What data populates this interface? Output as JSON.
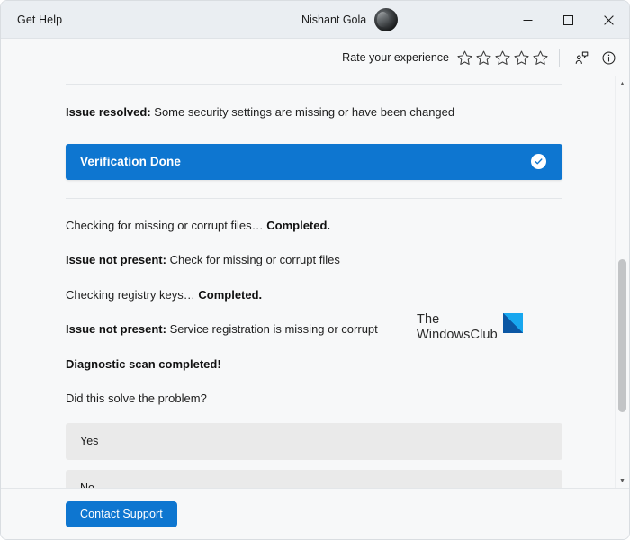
{
  "window": {
    "app_title": "Get Help",
    "account_name": "Nishant Gola",
    "controls": {
      "minimize": "Minimize",
      "maximize": "Maximize",
      "close": "Close"
    }
  },
  "ratebar": {
    "label": "Rate your experience",
    "stars": [
      {
        "index": 1,
        "filled": false
      },
      {
        "index": 2,
        "filled": false
      },
      {
        "index": 3,
        "filled": false
      },
      {
        "index": 4,
        "filled": false
      },
      {
        "index": 5,
        "filled": false
      }
    ],
    "rating_value": 0,
    "feedback_icon": "feedback-icon",
    "info_icon": "info-icon"
  },
  "content": {
    "issue_resolved": {
      "label": "Issue resolved:",
      "text": " Some security settings are missing or have been changed"
    },
    "banner": {
      "title": "Verification Done",
      "icon": "check-circle-icon",
      "color": "#0e76d0"
    },
    "log": [
      {
        "label": "",
        "text": "Checking for missing or corrupt files… ",
        "bold_tail": "Completed."
      },
      {
        "label": "Issue not present:",
        "text": " Check for missing or corrupt files",
        "bold_tail": ""
      },
      {
        "label": "",
        "text": "Checking registry keys… ",
        "bold_tail": "Completed."
      },
      {
        "label": "Issue not present:",
        "text": " Service registration is missing or corrupt",
        "bold_tail": ""
      }
    ],
    "scan_completed": "Diagnostic scan completed!",
    "question": "Did this solve the problem?",
    "answers": [
      {
        "label": "Yes"
      },
      {
        "label": "No"
      }
    ],
    "watermark": {
      "line1": "The",
      "line2": "WindowsClub",
      "logo_color": "#18a7ef"
    }
  },
  "scrollbar": {
    "up_arrow": "▲",
    "down_arrow": "▼",
    "thumb_top_pct": 44,
    "thumb_height_pct": 40
  },
  "footer": {
    "contact_support": "Contact Support"
  }
}
